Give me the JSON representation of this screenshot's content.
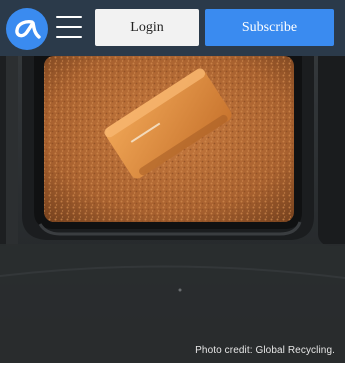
{
  "header": {
    "logo_icon": "alpha-logo-icon",
    "menu_icon": "hamburger-menu-icon",
    "login_label": "Login",
    "subscribe_label": "Subscribe"
  },
  "article": {
    "photo_credit": "Photo credit: Global Recycling."
  },
  "colors": {
    "header_bg": "#2b3a4a",
    "accent_blue": "#3a8bf0",
    "login_bg": "#f2f2f2"
  }
}
